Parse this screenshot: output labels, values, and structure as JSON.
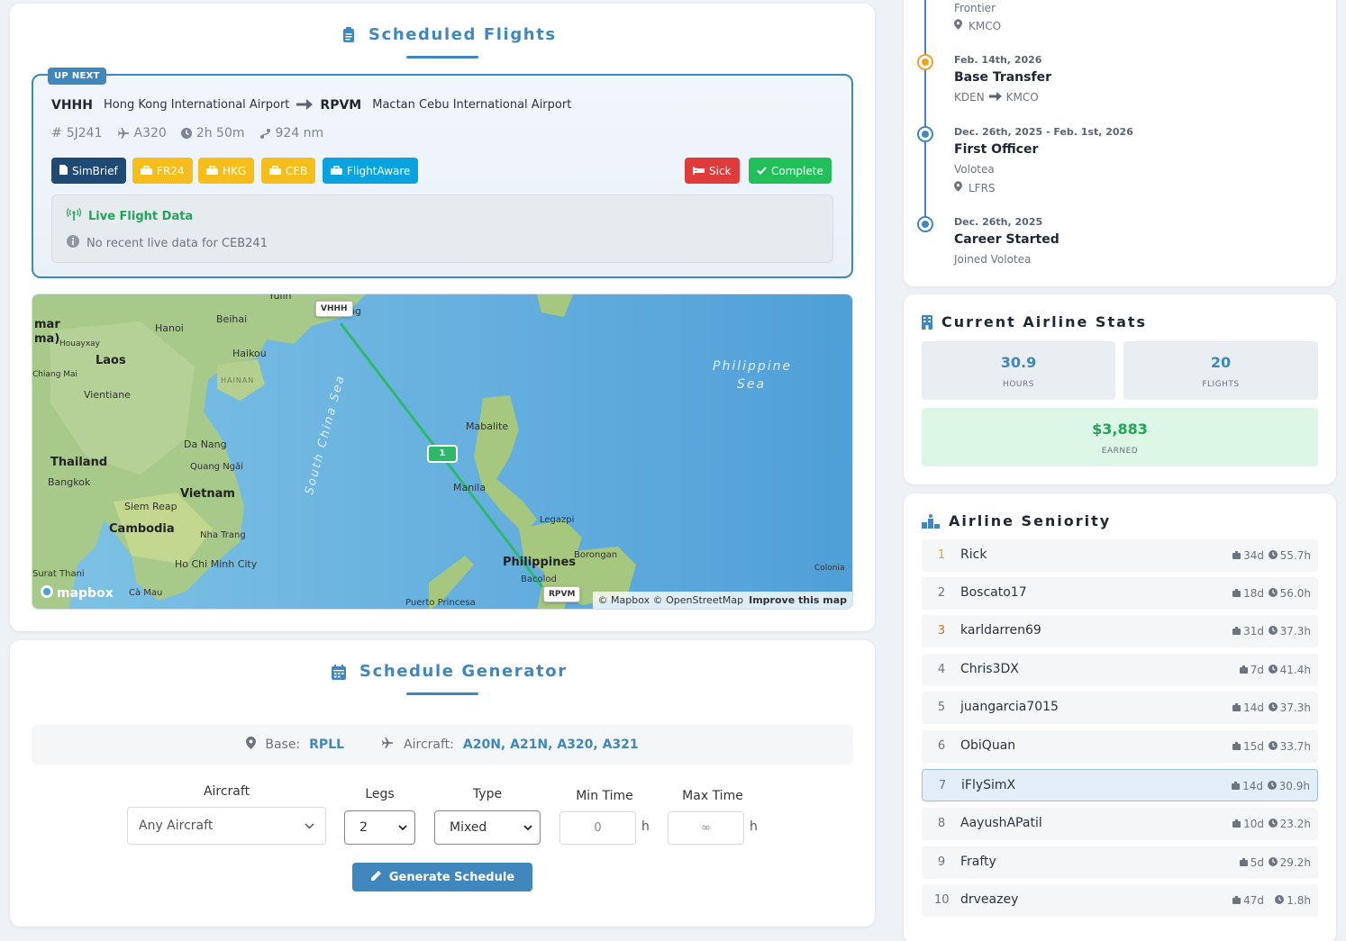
{
  "scheduled": {
    "title": "Scheduled Flights",
    "up_next_tag": "UP NEXT",
    "from_code": "VHHH",
    "from_name": "Hong Kong International Airport",
    "to_code": "RPVM",
    "to_name": "Mactan Cebu International Airport",
    "flight_no": "5J241",
    "aircraft": "A320",
    "duration": "2h 50m",
    "distance": "924 nm",
    "buttons": {
      "simbrief": "SimBrief",
      "fr24": "FR24",
      "hkg": "HKG",
      "ceb": "CEB",
      "flightaware": "FlightAware",
      "sick": "Sick",
      "complete": "Complete"
    },
    "live_title": "Live Flight Data",
    "live_text": "No recent live data for CEB241"
  },
  "map": {
    "labels": {
      "yulin": "Yulin",
      "beihai": "Beihai",
      "hanoi": "Hanoi",
      "mar": "mar",
      "maj": "ma)",
      "houayxay": "Houayxay",
      "laos": "Laos",
      "chiangmai": "Chiang Mai",
      "haikou": "Haikou",
      "hainan": "HAINAN",
      "vientiane": "Vientiane",
      "danang": "Da Nang",
      "quangngai": "Quang Ngãi",
      "thailand": "Thailand",
      "bangkok": "Bangkok",
      "vietnam": "Vietnam",
      "siemreap": "Siem Reap",
      "cambodia": "Cambodia",
      "nhatrang": "Nha Trang",
      "hochiminh": "Ho Chi Minh City",
      "suratthani": "Surat Thani",
      "camau": "Cà Mau",
      "mabalite": "Mabalite",
      "manila": "Manila",
      "legazpi": "Legazpi",
      "philippines": "Philippines",
      "borongan": "Borongan",
      "bacolod": "Bacolod",
      "puerto": "Puerto Princesa",
      "colonia": "Colonia",
      "southchinasea": "South China Sea",
      "philsea1": "Philippine",
      "philsea2": "Sea",
      "kong": "ng"
    },
    "origin_chip": "VHHH",
    "dest_chip": "RPVM",
    "leg_badge": "1",
    "attribution": "© Mapbox © OpenStreetMap",
    "improve": "Improve this map",
    "logo": "mapbox"
  },
  "generator": {
    "title": "Schedule Generator",
    "base_label": "Base:",
    "base_value": "RPLL",
    "aircraft_label": "Aircraft:",
    "aircraft_value": "A20N, A21N, A320, A321",
    "fields": {
      "aircraft_label": "Aircraft",
      "aircraft_value": "Any Aircraft",
      "legs_label": "Legs",
      "legs_value": "2",
      "type_label": "Type",
      "type_value": "Mixed",
      "min_label": "Min Time",
      "min_value": "0",
      "max_label": "Max Time",
      "max_placeholder": "∞",
      "unit": "h"
    },
    "button": "Generate Schedule"
  },
  "timeline": [
    {
      "title": "Frontier",
      "sub": "KMCO"
    },
    {
      "date": "Feb. 14th, 2026",
      "title": "Base Transfer",
      "from": "KDEN",
      "to": "KMCO"
    },
    {
      "date": "Dec. 26th, 2025 - Feb. 1st, 2026",
      "title": "First Officer",
      "airline": "Volotea",
      "sub": "LFRS"
    },
    {
      "date": "Dec. 26th, 2025",
      "title": "Career Started",
      "sub": "Joined Volotea"
    }
  ],
  "stats": {
    "title": "Current Airline Stats",
    "hours_value": "30.9",
    "hours_label": "HOURS",
    "flights_value": "20",
    "flights_label": "FLIGHTS",
    "earned_value": "$3,883",
    "earned_label": "EARNED"
  },
  "seniority": {
    "title": "Airline Seniority",
    "rows": [
      {
        "rank": "1",
        "name": "Rick",
        "days": "34d",
        "hours": "55.7h"
      },
      {
        "rank": "2",
        "name": "Boscato17",
        "days": "18d",
        "hours": "56.0h"
      },
      {
        "rank": "3",
        "name": "karldarren69",
        "days": "31d",
        "hours": "37.3h"
      },
      {
        "rank": "4",
        "name": "Chris3DX",
        "days": "7d",
        "hours": "41.4h"
      },
      {
        "rank": "5",
        "name": "juangarcia7015",
        "days": "14d",
        "hours": "37.3h"
      },
      {
        "rank": "6",
        "name": "ObiQuan",
        "days": "15d",
        "hours": "33.7h"
      },
      {
        "rank": "7",
        "name": "iFlySimX",
        "days": "14d",
        "hours": "30.9h"
      },
      {
        "rank": "8",
        "name": "AayushAPatil",
        "days": "10d",
        "hours": "23.2h"
      },
      {
        "rank": "9",
        "name": "Frafty",
        "days": "5d",
        "hours": "29.2h"
      },
      {
        "rank": "10",
        "name": "drveazey",
        "days": "47d",
        "hours": "1.8h"
      }
    ]
  },
  "colors": {
    "accent": "#3f87bd",
    "success": "#22a559",
    "danger": "#e03b3b",
    "warning": "#f5be1c",
    "info": "#0aa3e0",
    "dark": "#1f4a73"
  }
}
